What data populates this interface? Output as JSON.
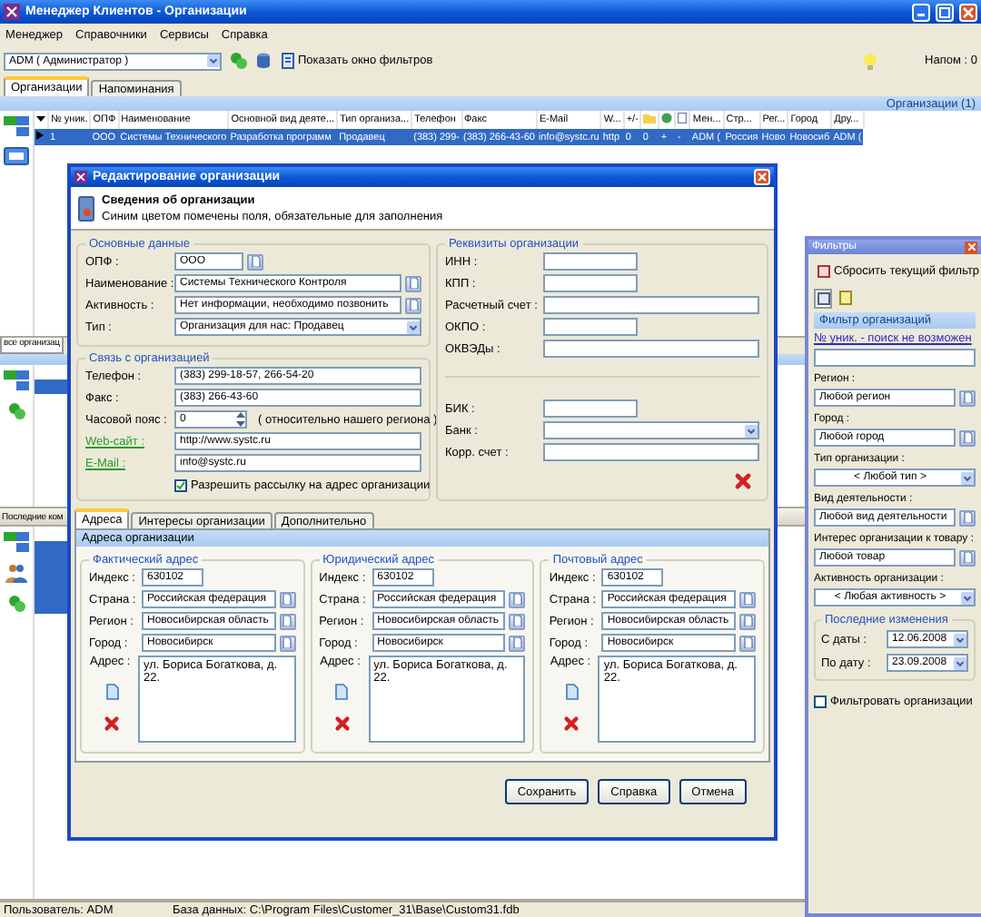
{
  "window": {
    "title": "Менеджер Клиентов - Организации",
    "menu": [
      "Менеджер",
      "Справочники",
      "Сервисы",
      "Справка"
    ],
    "user_select": "ADM ( Администратор )",
    "filter_button": "Показать окно фильтров",
    "reminders": "Напом : 0",
    "tabs": [
      {
        "label": "Организации",
        "selected": true
      },
      {
        "label": "Напоминания",
        "selected": false
      }
    ],
    "grid_title": "Организации (1)",
    "columns": [
      {
        "kind": "text",
        "label": "№ уник."
      },
      {
        "kind": "text",
        "label": "ОПФ"
      },
      {
        "kind": "text",
        "label": "Наименование"
      },
      {
        "kind": "text",
        "label": "Основной вид деяте..."
      },
      {
        "kind": "text",
        "label": "Тип организа..."
      },
      {
        "kind": "text",
        "label": "Телефон"
      },
      {
        "kind": "text",
        "label": "Факс"
      },
      {
        "kind": "text",
        "label": "E-Mail"
      },
      {
        "kind": "text",
        "label": "W..."
      },
      {
        "kind": "text",
        "label": "+/-"
      },
      {
        "kind": "folder"
      },
      {
        "kind": "globe"
      },
      {
        "kind": "page"
      },
      {
        "kind": "text",
        "label": "Мен..."
      },
      {
        "kind": "text",
        "label": "Стр..."
      },
      {
        "kind": "text",
        "label": "Рег..."
      },
      {
        "kind": "text",
        "label": "Город"
      },
      {
        "kind": "text",
        "label": "Дру..."
      }
    ],
    "rows": [
      {
        "selected": true,
        "cells": [
          "1",
          "ООО",
          "Системы Технического",
          "Разработка программ",
          "Продавец",
          "(383) 299-",
          "(383) 266-43-60",
          "info@systc.ru",
          "http",
          "0",
          "0",
          "+",
          "-",
          "ADM (",
          "Россия",
          "Ново",
          "Новосиб",
          "ADM ("
        ]
      }
    ],
    "side_tab": "все организац",
    "lower_section": "Последние ком",
    "status_bar": [
      "Пользователь: ADM",
      "База данных: C:\\Program Files\\Customer_31\\Base\\Custom31.fdb"
    ]
  },
  "dialog": {
    "title": "Редактирование организации",
    "heading": "Сведения об организации",
    "note": "Синим цветом помечены поля, обязательные для заполнения",
    "main_group": {
      "title": "Основные данные",
      "fields": [
        {
          "label": "ОПФ :",
          "value": "ООО",
          "kind": "short_lookup"
        },
        {
          "label": "Наименование :",
          "value": "Системы Технического Контроля",
          "kind": "lookup"
        },
        {
          "label": "Активность :",
          "value": "Нет информации, необходимо позвонить",
          "kind": "lookup"
        },
        {
          "label": "Тип :",
          "value": "Организация для нас: Продавец",
          "kind": "select"
        }
      ]
    },
    "contact_group": {
      "title": "Связь с организацией",
      "fields": [
        {
          "label": "Телефон :",
          "value": "(383) 299-18-57, 266-54-20",
          "kind": "text",
          "link": false
        },
        {
          "label": "Факс :",
          "value": "(383) 266-43-60",
          "kind": "text",
          "link": false
        },
        {
          "label": "Часовой пояс :",
          "value": "0",
          "kind": "spin",
          "note": "( относительно нашего региона )",
          "link": false
        },
        {
          "label": "Web-сайт :",
          "value": "http://www.systc.ru",
          "kind": "text",
          "link": true
        },
        {
          "label": "E-Mail :",
          "value": "info@systc.ru",
          "kind": "text",
          "link": true
        }
      ],
      "mailing": {
        "label": "Разрешить рассылку на адрес организации",
        "checked": true
      }
    },
    "requisites_group": {
      "title": "Реквизиты организации",
      "fields": [
        {
          "label": "ИНН :",
          "kind": "short"
        },
        {
          "label": "КПП :",
          "kind": "short"
        },
        {
          "label": "Расчетный счет :",
          "kind": "text"
        },
        {
          "label": "ОКПО :",
          "kind": "short"
        },
        {
          "label": "ОКВЭДы :",
          "kind": "text"
        }
      ],
      "bank_fields": [
        {
          "label": "БИК :",
          "kind": "short"
        },
        {
          "label": "Банк :",
          "kind": "select"
        },
        {
          "label": "Корр. счет :",
          "kind": "text"
        }
      ]
    },
    "tabs": [
      {
        "label": "Адреса",
        "selected": true
      },
      {
        "label": "Интересы организации",
        "selected": false
      },
      {
        "label": "Дополнительно",
        "selected": false
      }
    ],
    "tab_heading": "Адреса организации",
    "addresses": [
      {
        "title": "Фактический адрес",
        "fields": [
          {
            "label": "Индекс :",
            "value": "630102",
            "kind": "short"
          },
          {
            "label": "Страна :",
            "value": "Российская федерация",
            "kind": "lookup"
          },
          {
            "label": "Регион :",
            "value": "Новосибирская область",
            "kind": "lookup"
          },
          {
            "label": "Город :",
            "value": "Новосибирск",
            "kind": "lookup"
          }
        ],
        "address_label": "Адрес :",
        "address": "ул. Бориса Богаткова, д. 22."
      },
      {
        "title": "Юридический адрес",
        "fields": [
          {
            "label": "Индекс :",
            "value": "630102",
            "kind": "short"
          },
          {
            "label": "Страна :",
            "value": "Российская федерация",
            "kind": "lookup"
          },
          {
            "label": "Регион :",
            "value": "Новосибирская область",
            "kind": "lookup"
          },
          {
            "label": "Город :",
            "value": "Новосибирск",
            "kind": "lookup"
          }
        ],
        "address_label": "Адрес :",
        "address": "ул. Бориса Богаткова, д. 22."
      },
      {
        "title": "Почтовый адрес",
        "fields": [
          {
            "label": "Индекс :",
            "value": "630102",
            "kind": "short"
          },
          {
            "label": "Страна :",
            "value": "Российская федерация",
            "kind": "lookup"
          },
          {
            "label": "Регион :",
            "value": "Новосибирская область",
            "kind": "lookup"
          },
          {
            "label": "Город :",
            "value": "Новосибирск",
            "kind": "lookup"
          }
        ],
        "address_label": "Адрес :",
        "address": "ул. Бориса Богаткова, д. 22."
      }
    ],
    "buttons": [
      "Сохранить",
      "Справка",
      "Отмена"
    ]
  },
  "filters": {
    "title": "Фильтры",
    "reset": "Сбросить текущий фильтр",
    "heading": "Фильтр организаций",
    "id_link": "№ уник. - поиск не возможен",
    "fields": [
      {
        "label": "Регион :",
        "value": "Любой регион",
        "kind": "lookup"
      },
      {
        "label": "Город :",
        "value": "Любой город",
        "kind": "lookup"
      },
      {
        "label": "Тип организации :",
        "value": "< Любой тип >",
        "kind": "select"
      },
      {
        "label": "Вид деятельности :",
        "value": "Любой вид деятельности",
        "kind": "lookup"
      },
      {
        "label": "Интерес организации к товару :",
        "value": "Любой товар",
        "kind": "lookup"
      },
      {
        "label": "Активность организации :",
        "value": "< Любая активность >",
        "kind": "select"
      }
    ],
    "changes": {
      "title": "Последние изменения",
      "fields": [
        {
          "label": "С даты :",
          "value": "12.06.2008",
          "kind": "date"
        },
        {
          "label": "По дату :",
          "value": "23.09.2008",
          "kind": "date"
        }
      ]
    },
    "filter_check": {
      "label": "Фильтровать организации",
      "checked": false
    }
  }
}
